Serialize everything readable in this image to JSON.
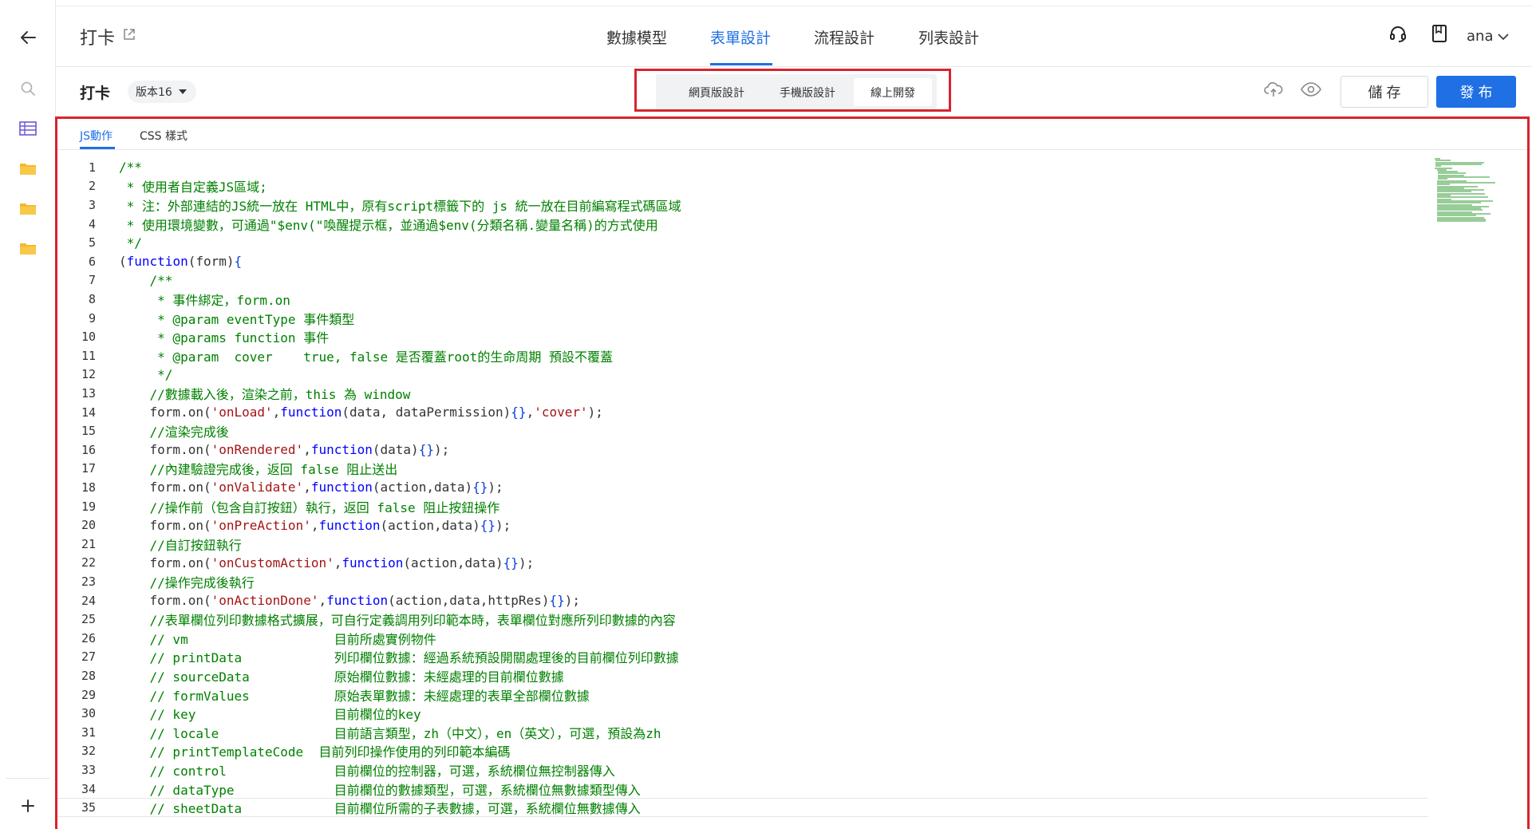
{
  "header": {
    "app_title": "打卡",
    "nav_tabs": [
      "數據模型",
      "表單設計",
      "流程設計",
      "列表設計"
    ],
    "active_tab_index": 1,
    "user_name": "ana"
  },
  "toolbar": {
    "form_name": "打卡",
    "version_label": "版本16",
    "design_modes": [
      "網頁版設計",
      "手機版設計",
      "線上開發"
    ],
    "active_mode_index": 2,
    "save_label": "儲 存",
    "publish_label": "發 布"
  },
  "editor": {
    "sub_tabs": [
      "JS動作",
      "CSS 樣式"
    ],
    "active_sub_tab_index": 0,
    "current_line": 35,
    "lines": [
      {
        "n": "1",
        "t": "/**"
      },
      {
        "n": "2",
        "t": " * 使用者自定義JS區域;"
      },
      {
        "n": "3",
        "t": " * 注：外部連結的JS統一放在 HTML中，原有script標籤下的 js 統一放在目前編寫程式碼區域"
      },
      {
        "n": "4",
        "t": " * 使用環境變數，可通過\"$env(\"喚醒提示框，並通過$env(分類名稱.變量名稱)的方式使用"
      },
      {
        "n": "5",
        "t": " */"
      },
      {
        "n": "6",
        "t": "(function(form){"
      },
      {
        "n": "7",
        "t": "    /**"
      },
      {
        "n": "8",
        "t": "     * 事件綁定，form.on"
      },
      {
        "n": "9",
        "t": "     * @param eventType 事件類型"
      },
      {
        "n": "10",
        "t": "     * @params function 事件"
      },
      {
        "n": "11",
        "t": "     * @param  cover    true, false 是否覆蓋root的生命周期 預設不覆蓋"
      },
      {
        "n": "12",
        "t": "     */"
      },
      {
        "n": "13",
        "t": "    //數據載入後，渲染之前，this 為 window"
      },
      {
        "n": "14",
        "t": "    form.on('onLoad',function(data, dataPermission){},'cover');"
      },
      {
        "n": "15",
        "t": "    //渲染完成後"
      },
      {
        "n": "16",
        "t": "    form.on('onRendered',function(data){});"
      },
      {
        "n": "17",
        "t": "    //內建驗證完成後，返回 false 阻止送出"
      },
      {
        "n": "18",
        "t": "    form.on('onValidate',function(action,data){});"
      },
      {
        "n": "19",
        "t": "    //操作前（包含自訂按鈕）執行，返回 false 阻止按鈕操作"
      },
      {
        "n": "20",
        "t": "    form.on('onPreAction',function(action,data){});"
      },
      {
        "n": "21",
        "t": "    //自訂按鈕執行"
      },
      {
        "n": "22",
        "t": "    form.on('onCustomAction',function(action,data){});"
      },
      {
        "n": "23",
        "t": "    //操作完成後執行"
      },
      {
        "n": "24",
        "t": "    form.on('onActionDone',function(action,data,httpRes){});"
      },
      {
        "n": "25",
        "t": "    //表單欄位列印數據格式擴展，可自行定義調用列印範本時，表單欄位對應所列印數據的內容"
      },
      {
        "n": "26",
        "t": "    // vm                   目前所處實例物件"
      },
      {
        "n": "27",
        "t": "    // printData            列印欄位數據：經過系統預設開關處理後的目前欄位列印數據"
      },
      {
        "n": "28",
        "t": "    // sourceData           原始欄位數據：未經處理的目前欄位數據"
      },
      {
        "n": "29",
        "t": "    // formValues           原始表單數據：未經處理的表單全部欄位數據"
      },
      {
        "n": "30",
        "t": "    // key                  目前欄位的key"
      },
      {
        "n": "31",
        "t": "    // locale               目前語言類型，zh（中文），en（英文），可選，預設為zh"
      },
      {
        "n": "32",
        "t": "    // printTemplateCode  目前列印操作使用的列印範本編碼"
      },
      {
        "n": "33",
        "t": "    // control              目前欄位的控制器，可選，系統欄位無控制器傳入"
      },
      {
        "n": "34",
        "t": "    // dataType             目前欄位的數據類型，可選，系統欄位無數據類型傳入"
      },
      {
        "n": "35",
        "t": "    // sheetData            目前欄位所需的子表數據，可選，系統欄位無數據傳入"
      }
    ]
  },
  "colors": {
    "accent": "#1f6fe5",
    "highlight": "#d8242d",
    "comment": "#008000",
    "keyword": "#0000ff",
    "string": "#a31515"
  }
}
